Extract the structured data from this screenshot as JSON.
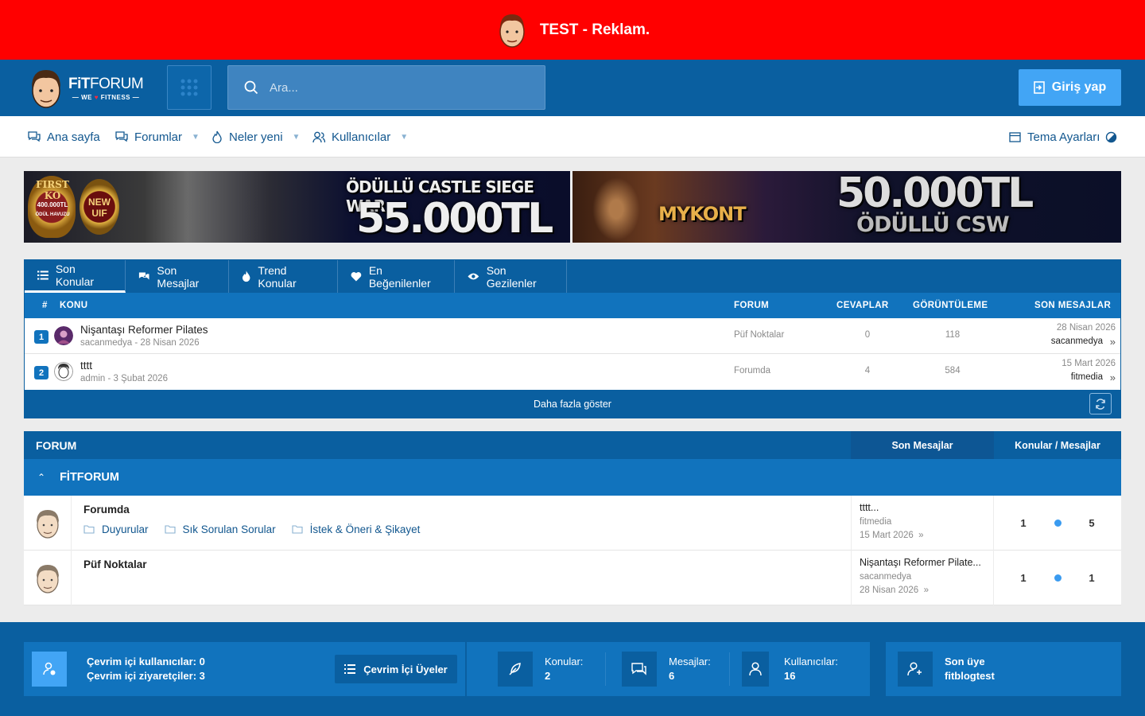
{
  "ad": {
    "text": "TEST - Reklam."
  },
  "header": {
    "logo": {
      "brand_bold": "FiT",
      "brand_rest": "FORUM",
      "tag_left": "— WE",
      "tag_heart": "♥",
      "tag_right": "FITNESS —"
    },
    "search_placeholder": "Ara...",
    "login_label": "Giriş yap"
  },
  "nav": {
    "items": [
      {
        "label": "Ana sayfa",
        "icon": "comments-icon"
      },
      {
        "label": "Forumlar",
        "icon": "comments-icon",
        "dropdown": true
      },
      {
        "label": "Neler yeni",
        "icon": "flame-icon",
        "dropdown": true
      },
      {
        "label": "Kullanıcılar",
        "icon": "users-icon",
        "dropdown": true
      }
    ],
    "theme_settings": "Tema Ayarları"
  },
  "banners": [
    {
      "badge1": "FIRST KO",
      "badge1_sub": "400.000TL",
      "badge1_sub2": "ÖDÜL HAVUZU",
      "badge2": "NEW UIF",
      "headline": "ÖDÜLLÜ CASTLE SIEGE WAR",
      "amount": "55.000TL"
    },
    {
      "logo": "MYKONT",
      "amount": "50.000TL",
      "sub": "ÖDÜLLÜ CSW"
    }
  ],
  "latest": {
    "tabs": [
      {
        "label": "Son Konular",
        "icon": "list-icon",
        "active": true
      },
      {
        "label": "Son Mesajlar",
        "icon": "chat-icon"
      },
      {
        "label": "Trend Konular",
        "icon": "fire-icon"
      },
      {
        "label": "En Beğenilenler",
        "icon": "heart-icon"
      },
      {
        "label": "Son Gezilenler",
        "icon": "eye-icon"
      }
    ],
    "columns": {
      "num": "#",
      "topic": "KONU",
      "forum": "FORUM",
      "replies": "CEVAPLAR",
      "views": "GÖRÜNTÜLEME",
      "last": "SON MESAJLAR"
    },
    "rows": [
      {
        "num": "1",
        "title": "Nişantaşı Reformer Pilates",
        "meta": "sacanmedya - 28 Nisan 2026",
        "forum": "Püf Noktalar",
        "replies": "0",
        "views": "118",
        "last_date": "28 Nisan 2026",
        "last_user": "sacanmedya"
      },
      {
        "num": "2",
        "title": "tttt",
        "meta": "admin - 3 Şubat 2026",
        "forum": "Forumda",
        "replies": "4",
        "views": "584",
        "last_date": "15 Mart 2026",
        "last_user": "fitmedia"
      }
    ],
    "more_label": "Daha fazla göster"
  },
  "forums": {
    "header": {
      "label": "FORUM",
      "last_posts": "Son Mesajlar",
      "counts": "Konular / Mesajlar"
    },
    "category": "FİTFORUM",
    "rows": [
      {
        "name": "Forumda",
        "subforums": [
          "Duyurular",
          "Sık Sorulan Sorular",
          "İstek & Öneri & Şikayet"
        ],
        "last_title": "tttt...",
        "last_user": "fitmedia",
        "last_date": "15 Mart 2026",
        "topics": "1",
        "messages": "5"
      },
      {
        "name": "Püf Noktalar",
        "subforums": [],
        "last_title": "Nişantaşı Reformer Pilate...",
        "last_user": "sacanmedya",
        "last_date": "28 Nisan 2026",
        "topics": "1",
        "messages": "1"
      }
    ]
  },
  "footer": {
    "online_users_label": "Çevrim içi kullanıcılar:",
    "online_users": "0",
    "online_guests_label": "Çevrim içi ziyaretçiler:",
    "online_guests": "3",
    "online_button": "Çevrim İçi Üyeler",
    "topics_label": "Konular:",
    "topics": "2",
    "messages_label": "Mesajlar:",
    "messages": "6",
    "users_label": "Kullanıcılar:",
    "users": "16",
    "newest_label": "Son üye",
    "newest": "fitblogtest"
  },
  "colors": {
    "ad": "#ff0000",
    "primary": "#0a5fa0",
    "secondary": "#1173bd",
    "accent": "#42a5f5"
  }
}
